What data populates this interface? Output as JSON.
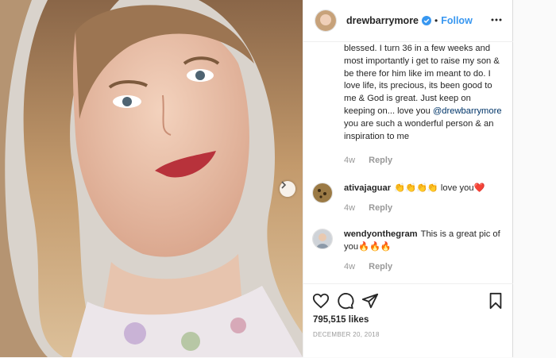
{
  "post": {
    "username": "drewbarrymore",
    "follow_label": "Follow",
    "separator": "•",
    "caption_part1": "blessed. I turn 36 in a few weeks and most importantly i get to raise my son & be there for him like im meant to do. I love life, its precious, its been good to me & God is great. Just keep on keeping on... love you ",
    "caption_mention": "@drewbarrymore",
    "caption_part2": " you are such a wonderful person & an inspiration to me",
    "caption_age": "4w",
    "reply_label": "Reply",
    "likes": "795,515 likes",
    "date": "DECEMBER 20, 2018"
  },
  "comments": [
    {
      "username": "ativajaguar",
      "text": "👏👏👏👏 love you❤️",
      "age": "4w",
      "reply": "Reply"
    },
    {
      "username": "wendyonthegram",
      "text": "This is a great pic of you🔥🔥🔥",
      "age": "4w",
      "reply": "Reply"
    }
  ],
  "colors": {
    "accent": "#3897f0",
    "mention": "#003569",
    "muted": "#999999",
    "lipstick": "#b8323b"
  },
  "icons": [
    "verified-badge-icon",
    "more-options-icon",
    "next-arrow-icon",
    "heart-icon",
    "comment-icon",
    "share-icon",
    "bookmark-icon"
  ]
}
